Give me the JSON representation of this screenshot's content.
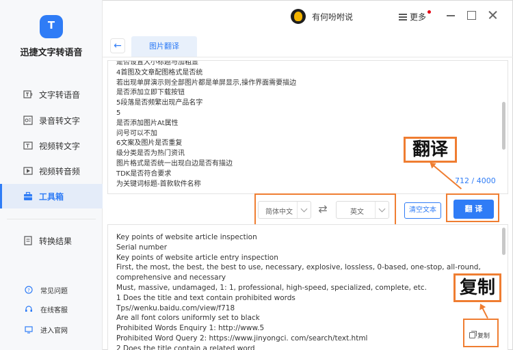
{
  "app": {
    "name": "迅捷文字转语音"
  },
  "sidebar": {
    "items": [
      {
        "label": "文字转语音",
        "icon": "text-to-speech-icon"
      },
      {
        "label": "录音转文字",
        "icon": "recording-to-text-icon"
      },
      {
        "label": "视频转文字",
        "icon": "video-to-text-icon"
      },
      {
        "label": "视频转音频",
        "icon": "video-to-audio-icon"
      },
      {
        "label": "工具箱",
        "icon": "toolbox-icon",
        "active": true
      }
    ],
    "results": {
      "label": "转换结果",
      "icon": "results-icon"
    },
    "footer": [
      {
        "label": "常见问题",
        "icon": "faq-icon"
      },
      {
        "label": "在线客服",
        "icon": "headset-icon"
      },
      {
        "label": "进入官网",
        "icon": "website-icon"
      }
    ]
  },
  "header": {
    "username": "有何吩咐说",
    "more_label": "更多"
  },
  "tabs": [
    {
      "label": "图片翻译",
      "active": true
    }
  ],
  "source": {
    "lines": [
      "是否设置大小标题与加粗显",
      "4首图及文章配图格式是否统",
      "若出现单屏演示则全部图片都是单屏显示,操作界面需要描边",
      "是否添加立即下载按钮",
      "5段落是否频繁出现产品名字",
      "5",
      "是否添加图片At属性",
      "问号可以不加",
      "6文案及图片是否重复",
      "级分类是否为热门资讯",
      "图片格式是否统一出现白边是否有描边",
      "TDK是否符合要求",
      "为关键词标题-首款软件名称"
    ],
    "char_count": "712 / 4000"
  },
  "controls": {
    "source_lang": "简体中文",
    "target_lang": "英文",
    "clear_label": "清空文本",
    "translate_label": "翻 译"
  },
  "output": {
    "lines": [
      "Key points of website article inspection",
      "Serial number",
      "Key points of website article entry inspection",
      "First, the most, the best, the best to use, necessary, explosive, lossless, 0-based, one-stop, all-round, comprehensive and necessary",
      "Must, massive, undamaged, 1: 1, professional, high-speed, specialized, complete, etc.",
      "1 Does the title and text contain prohibited words",
      "Tps//wenku.baidu.com/view/f718",
      "Are all font colors uniformly set to black",
      "Prohibited Words Enquiry 1: http://www.5",
      "Prohibited Word Query 2: https://www.jinyongci. com/search/text.html",
      "2 Does the title contain a related word"
    ],
    "copy_label": "复制"
  },
  "annotations": {
    "translate_callout": "翻译",
    "copy_callout": "复制",
    "color": "#ef7d31"
  },
  "colors": {
    "accent": "#2f7cf6"
  }
}
